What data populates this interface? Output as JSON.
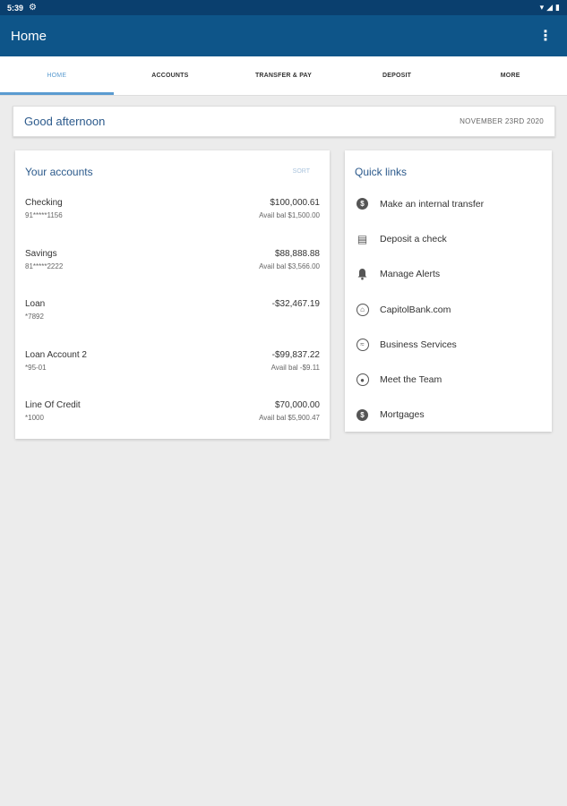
{
  "status_bar": {
    "time": "5:39",
    "gear": "⚙",
    "wifi": "▾",
    "signal": "◢",
    "battery": "▮"
  },
  "app_bar": {
    "title": "Home",
    "overflow": "⋮"
  },
  "tabs": [
    {
      "label": "HOME",
      "active": true
    },
    {
      "label": "ACCOUNTS"
    },
    {
      "label": "TRANSFER & PAY"
    },
    {
      "label": "DEPOSIT"
    },
    {
      "label": "MORE"
    }
  ],
  "greeting": {
    "text": "Good afternoon",
    "date": "NOVEMBER 23RD 2020"
  },
  "accounts": {
    "title": "Your accounts",
    "sort_label": "SORT",
    "items": [
      {
        "name": "Checking",
        "number": "91*****1156",
        "amount": "$100,000.61",
        "avail": "Avail bal $1,500.00"
      },
      {
        "name": "Savings",
        "number": "81*****2222",
        "amount": "$88,888.88",
        "avail": "Avail bal $3,566.00"
      },
      {
        "name": "Loan",
        "number": "*7892",
        "amount": "-$32,467.19",
        "avail": ""
      },
      {
        "name": "Loan Account 2",
        "number": "*95-01",
        "amount": "-$99,837.22",
        "avail": "Avail bal -$9.11"
      },
      {
        "name": "Line Of Credit",
        "number": "*1000",
        "amount": "$70,000.00",
        "avail": "Avail bal $5,900.47"
      }
    ]
  },
  "quick_links": {
    "title": "Quick links",
    "items": [
      {
        "label": "Make an internal transfer",
        "icon": "transfer-icon",
        "glyph": "$"
      },
      {
        "label": "Deposit a check",
        "icon": "check-deposit-icon",
        "glyph": "▤"
      },
      {
        "label": "Manage Alerts",
        "icon": "bell-icon",
        "glyph": "🔔"
      },
      {
        "label": "CapitolBank.com",
        "icon": "bank-icon",
        "glyph": "⌂"
      },
      {
        "label": "Business Services",
        "icon": "handshake-icon",
        "glyph": "≈"
      },
      {
        "label": "Meet the Team",
        "icon": "person-icon",
        "glyph": "●"
      },
      {
        "label": "Mortgages",
        "icon": "mortgage-icon",
        "glyph": "$"
      }
    ]
  }
}
